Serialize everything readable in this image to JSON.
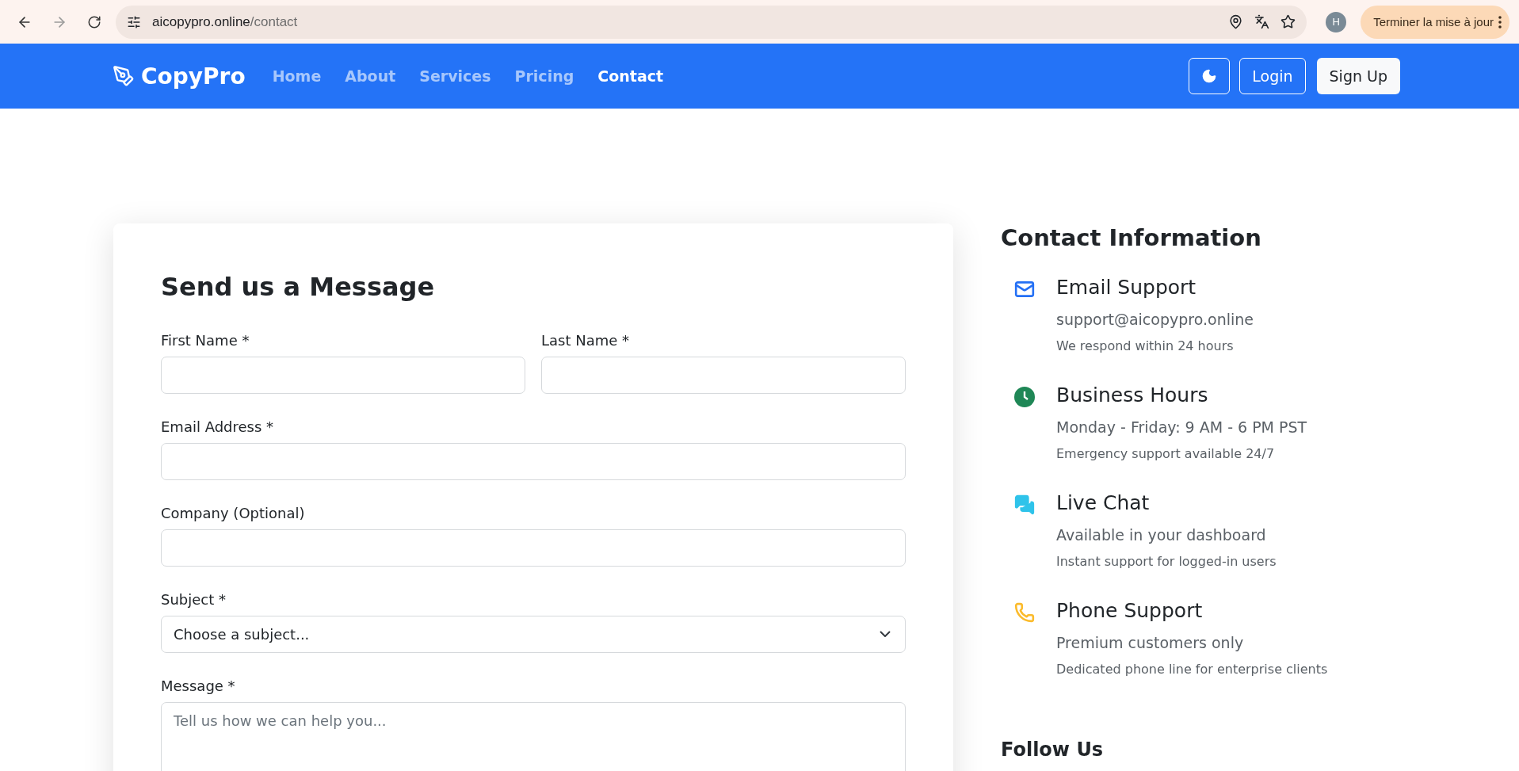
{
  "browser": {
    "back_disabled": false,
    "forward_disabled": true,
    "url_host": "aicopypro.online",
    "url_path": "/contact",
    "avatar": "H",
    "update_button": "Terminer la mise à jour"
  },
  "navbar": {
    "brand": "CopyPro",
    "links": [
      {
        "label": "Home",
        "selected": false
      },
      {
        "label": "About",
        "selected": false
      },
      {
        "label": "Services",
        "selected": false
      },
      {
        "label": "Pricing",
        "selected": false
      },
      {
        "label": "Contact",
        "selected": true
      }
    ],
    "login": "Login",
    "signup": "Sign Up"
  },
  "form": {
    "title": "Send us a Message",
    "rows": [
      [
        {
          "kind": "text",
          "label": "First Name *"
        },
        {
          "kind": "text",
          "label": "Last Name *"
        }
      ],
      [
        {
          "kind": "text",
          "label": "Email Address *"
        }
      ],
      [
        {
          "kind": "text",
          "label": "Company (Optional)"
        }
      ],
      [
        {
          "kind": "select",
          "label": "Subject *",
          "value": "Choose a subject..."
        }
      ],
      [
        {
          "kind": "textarea",
          "label": "Message *",
          "placeholder": "Tell us how we can help you..."
        }
      ]
    ]
  },
  "contact": {
    "title": "Contact Information",
    "items": [
      {
        "kind": "email",
        "color": "#2470f5",
        "title": "Email Support",
        "line": "support@aicopypro.online",
        "note": "We respond within 24 hours"
      },
      {
        "kind": "clock",
        "color": "#1f8756",
        "title": "Business Hours",
        "line": "Monday - Friday: 9 AM - 6 PM PST",
        "note": "Emergency support available 24/7"
      },
      {
        "kind": "chat",
        "color": "#2fc3ea",
        "title": "Live Chat",
        "line": "Available in your dashboard",
        "note": "Instant support for logged-in users"
      },
      {
        "kind": "phone",
        "color": "#fbbb2c",
        "title": "Phone Support",
        "line": "Premium customers only",
        "note": "Dedicated phone line for enterprise clients"
      }
    ],
    "follow_title": "Follow Us"
  }
}
